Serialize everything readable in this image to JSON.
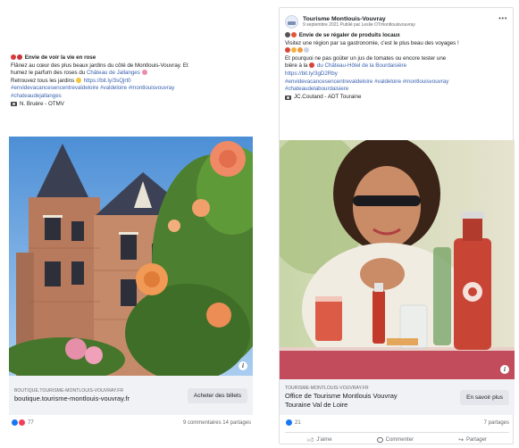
{
  "left_post": {
    "text": {
      "title": "Envie de voir la vie en rose",
      "line2": "Flânez au cœur des plus beaux jardins du côté de Montlouis-Vouvray. Et",
      "line3_prefix": "humez le parfum des roses du ",
      "line3_link": "Château de Jallanges",
      "line4_prefix": "Retrouvez tous les jardins ",
      "line4_link": "https://bit.ly/3sQjrt0",
      "hashtags1": "#envidevacancesencentrevaldeloire #valdeloire #montlouisvouvray",
      "hashtags2": "#chateaudejallanges",
      "credit": "N. Bruère - OTMV"
    },
    "link_preview": {
      "domain": "BOUTIQUE.TOURISME-MONTLOUIS-VOUVRAY.FR",
      "title": "boutique.tourisme-montlouis-vouvray.fr",
      "cta": "Acheter des billets"
    },
    "stats": {
      "reactions": "77",
      "comments_shares": "9 commentaires  14 partages"
    }
  },
  "right_post": {
    "header": {
      "page_name": "Tourisme Montlouis-Vouvray",
      "subline": "9 septembre 2021 Publié par Leslie OTmontlouisvouvray",
      "more": "•••"
    },
    "text": {
      "title": "Envie de se régaler de produits locaux",
      "line2": "Visitez une région par sa gastronomie, c'est le plus beau des voyages !",
      "line3": "Et pourquoi ne pas goûter un jus de tomates ou encore tester une",
      "line4_prefix": "bière à la ",
      "line4_link": "du Château-Hôtel de la Bourdaisière",
      "line5_link": "https://bit.ly/3gD2Rby",
      "hashtags1": "#envidevacancesencentrevaldeloire #valdeloire #montlouisvouvray",
      "hashtags2": "#chateaudelabourdaisiere",
      "credit": "JC.Coutand - ADT Touraine"
    },
    "link_preview": {
      "domain": "TOURISME-MONTLOUIS-VOUVRAY.FR",
      "title_line1": "Office de Tourisme Montlouis Vouvray",
      "title_line2": "Touraine Val de Loire",
      "cta": "En savoir plus"
    },
    "stats": {
      "reactions": "21",
      "shares": "7 partages"
    },
    "actions": {
      "like": "J'aime",
      "comment": "Commenter",
      "share": "Partager"
    }
  },
  "colors": {
    "link": "#3a62b0",
    "like": "#1877f2",
    "love": "#f33e58",
    "preview_bg": "#f0f2f5"
  }
}
